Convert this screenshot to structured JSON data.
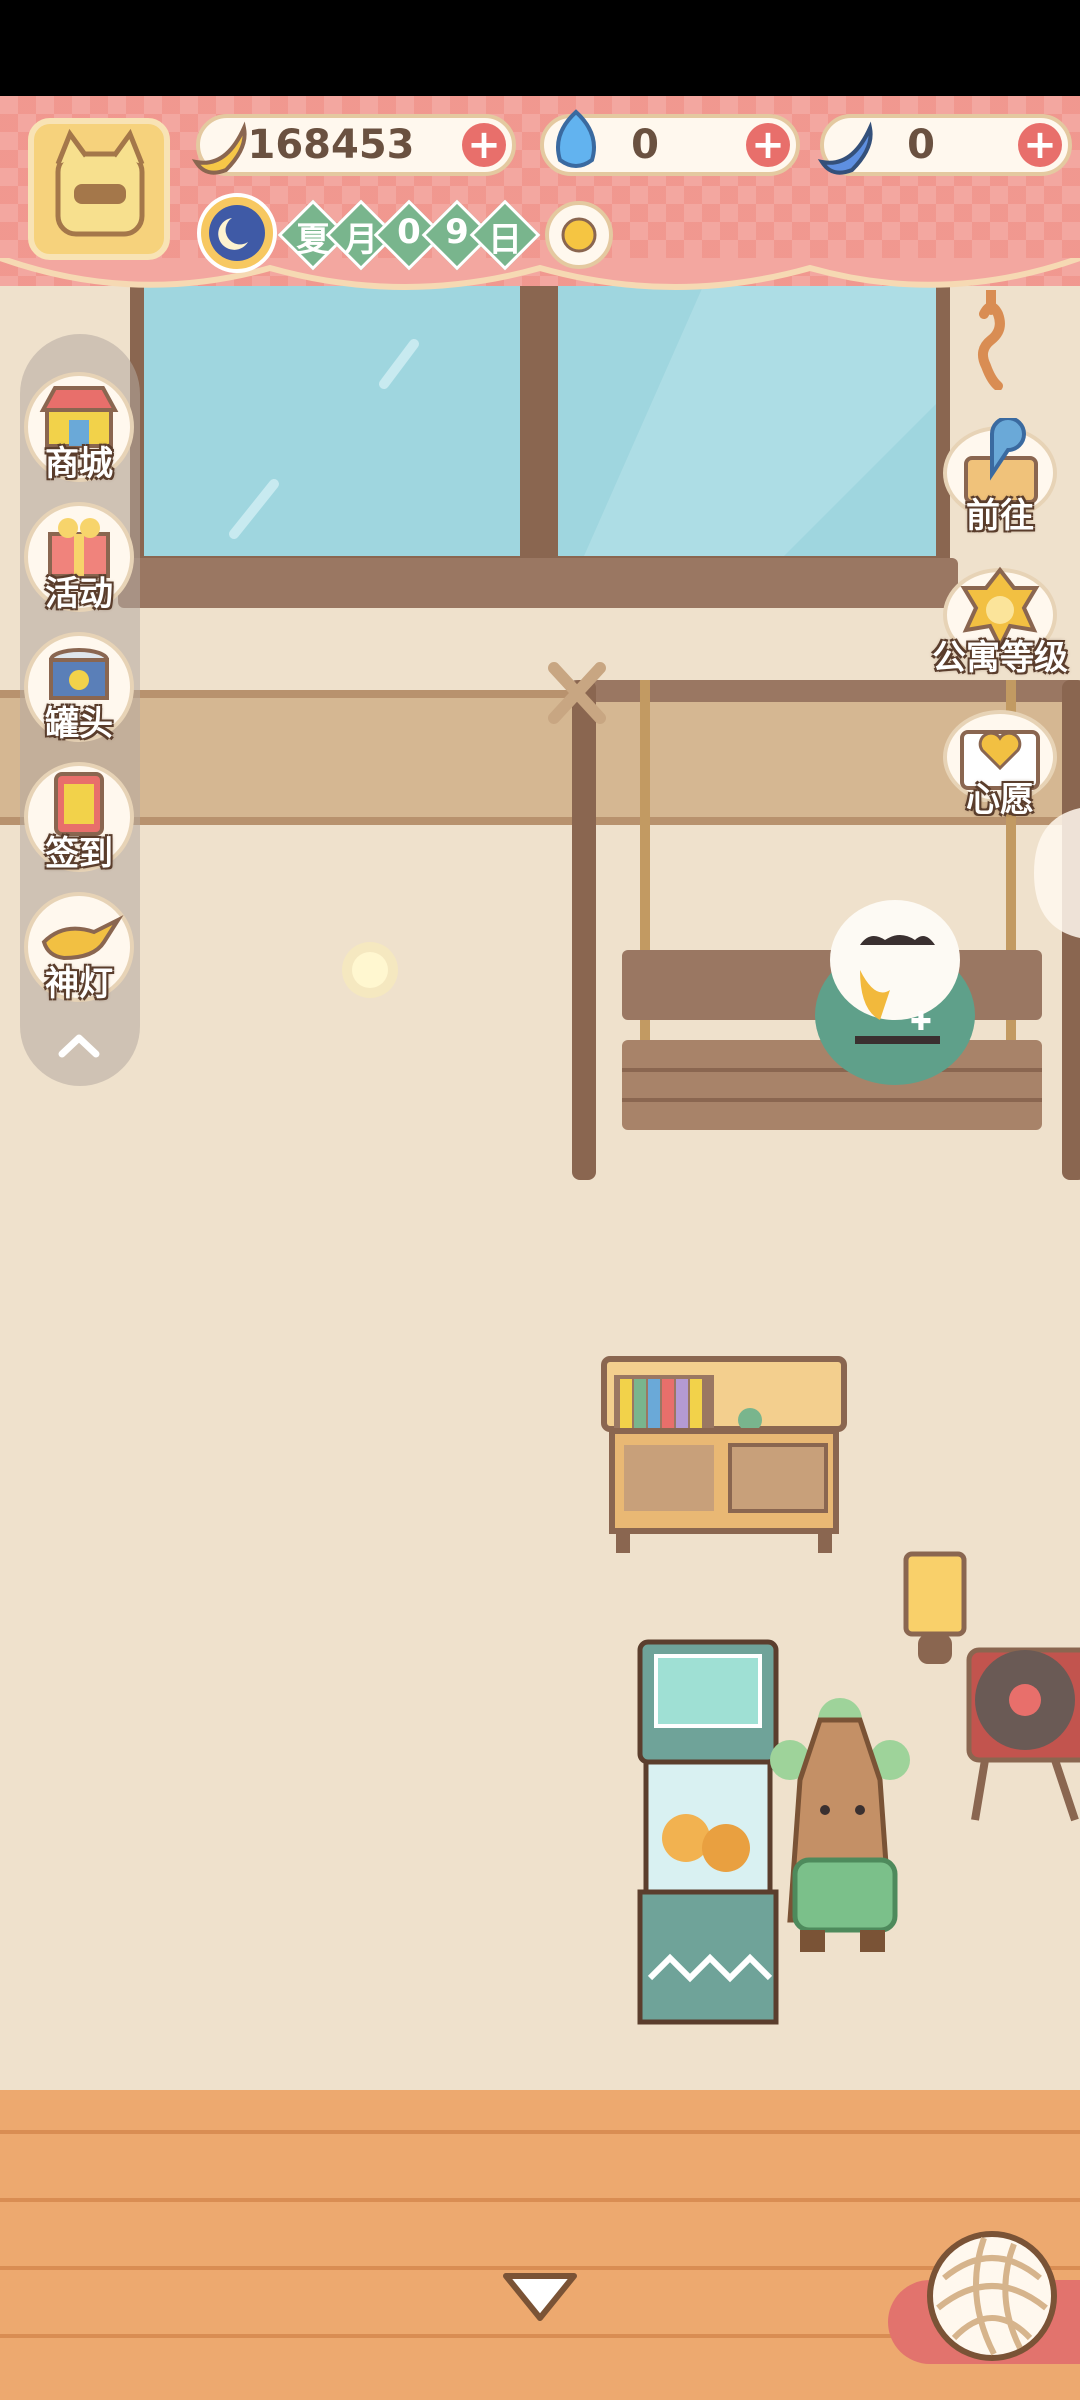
{
  "header": {
    "currencies": [
      {
        "name": "banana-icon",
        "value": "168453"
      },
      {
        "name": "blue-flame-icon",
        "value": "0"
      },
      {
        "name": "blue-banana-icon",
        "value": "0"
      }
    ],
    "date": {
      "season": "夏",
      "unit_month": "月",
      "day_digit_1": "0",
      "day_digit_2": "9",
      "unit_day": "日"
    },
    "icons": {
      "avatar": "cat-avatar-icon",
      "moon": "moon-clock-icon",
      "weather": "sun-icon"
    }
  },
  "left_menu": {
    "items": [
      {
        "label": "商城",
        "icon": "shop-icon"
      },
      {
        "label": "活动",
        "icon": "gift-icon"
      },
      {
        "label": "罐头",
        "icon": "can-icon"
      },
      {
        "label": "签到",
        "icon": "checkin-icon"
      },
      {
        "label": "神灯",
        "icon": "magic-lamp-icon"
      }
    ],
    "collapse_glyph": "^"
  },
  "right_menu": {
    "items": [
      {
        "label": "前往",
        "icon": "map-pin-icon"
      },
      {
        "label": "公寓等级",
        "icon": "apartment-level-icon"
      },
      {
        "label": "心愿",
        "icon": "heart-book-icon"
      }
    ]
  },
  "colors": {
    "accent": "#e86f6b",
    "banner": "#f3a7a0",
    "wall": "#efe1cc",
    "floor": "#eda96f",
    "green": "#79b58d"
  }
}
